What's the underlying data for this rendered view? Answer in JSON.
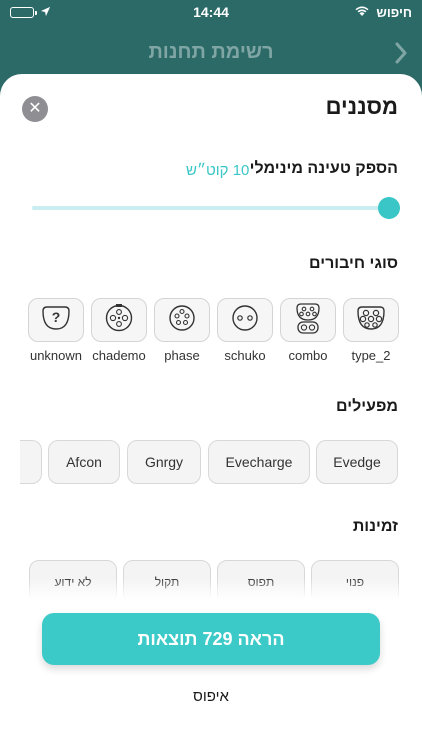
{
  "status_bar": {
    "carrier": "חיפוש",
    "time": "14:44"
  },
  "nav": {
    "title": "רשימת תחנות",
    "back_icon": "chevron-right-icon"
  },
  "sheet": {
    "title": "מסננים",
    "close_icon": "close-icon",
    "power": {
      "label": "הספק טעינה מינימלי",
      "value": "10 קוט״ש",
      "slider_fraction": 1.0
    },
    "connectors": {
      "label": "סוגי חיבורים",
      "items": [
        {
          "label": "type_2",
          "icon": "type2-plug-icon"
        },
        {
          "label": "combo",
          "icon": "combo-plug-icon"
        },
        {
          "label": "schuko",
          "icon": "schuko-plug-icon"
        },
        {
          "label": "phase",
          "icon": "phase-plug-icon"
        },
        {
          "label": "chademo",
          "icon": "chademo-plug-icon"
        },
        {
          "label": "unknown",
          "icon": "unknown-plug-icon"
        }
      ]
    },
    "operators": {
      "label": "מפעילים",
      "items": [
        "Evedge",
        "Evecharge",
        "Gnrgy",
        "Afcon"
      ]
    },
    "availability": {
      "label": "זמינות",
      "items": [
        "פנוי",
        "תפוס",
        "תקול",
        "לא ידוע"
      ]
    },
    "show_button": "הראה 729 תוצאות",
    "reset_label": "איפוס"
  },
  "colors": {
    "accent": "#3ccac8",
    "header_bg": "#2c6a68",
    "slider_track": "#c9edf0"
  }
}
